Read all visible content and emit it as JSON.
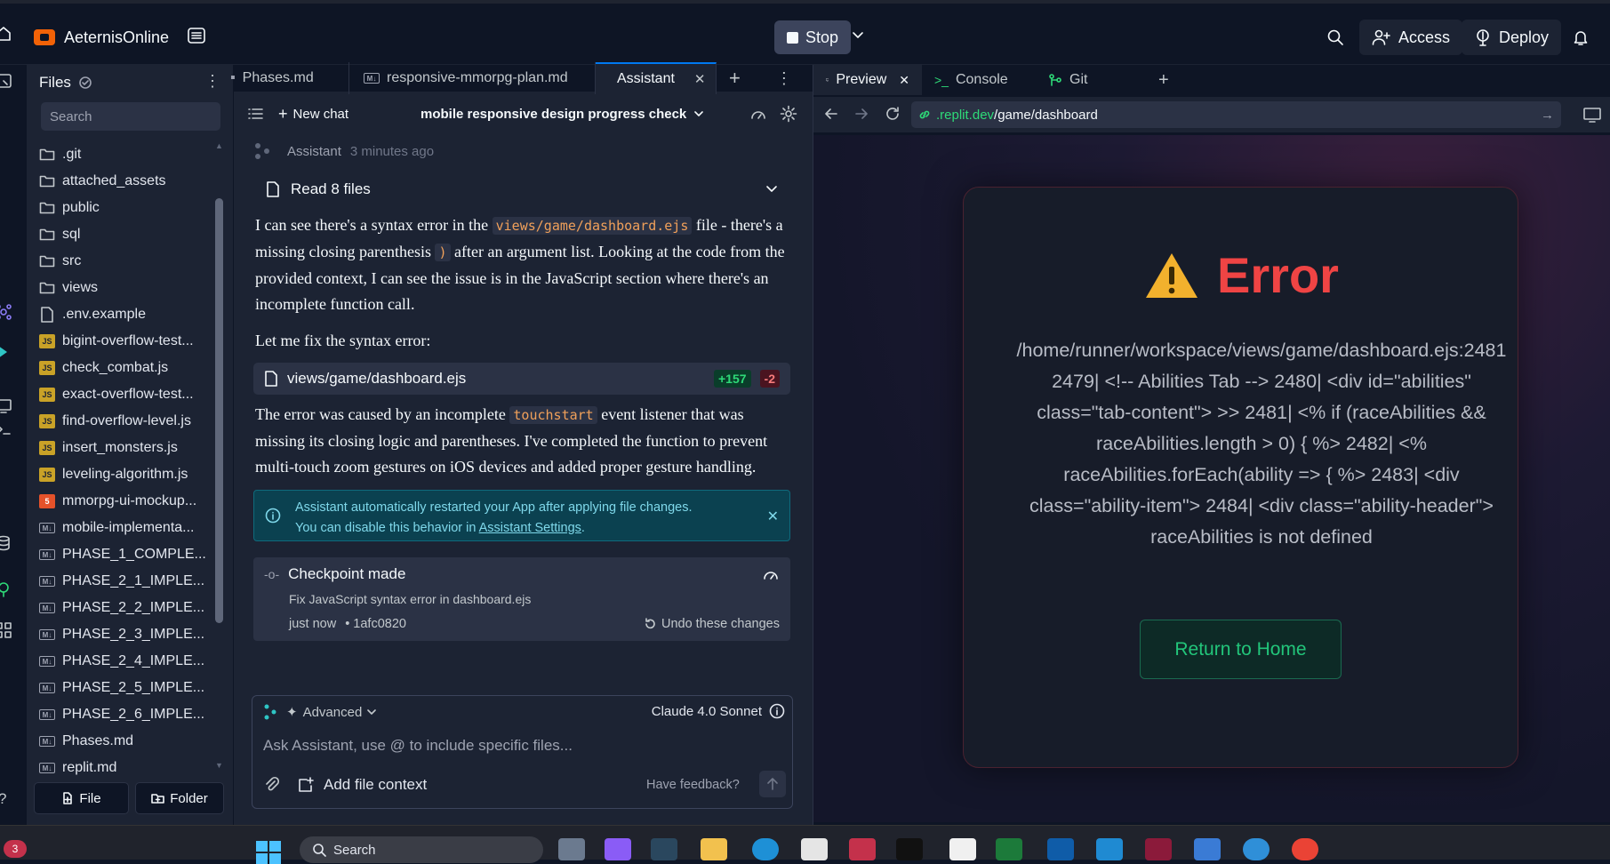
{
  "topbar": {
    "repl_name": "AeternisOnline",
    "stop_label": "Stop",
    "access_label": "Access",
    "deploy_label": "Deploy"
  },
  "files": {
    "title": "Files",
    "search_placeholder": "Search",
    "items": [
      {
        "name": ".git",
        "icon": "folder-icon"
      },
      {
        "name": "attached_assets",
        "icon": "folder-icon"
      },
      {
        "name": "public",
        "icon": "folder-icon"
      },
      {
        "name": "sql",
        "icon": "folder-icon"
      },
      {
        "name": "src",
        "icon": "folder-icon"
      },
      {
        "name": "views",
        "icon": "folder-icon"
      },
      {
        "name": ".env.example",
        "icon": "file-icon"
      },
      {
        "name": "bigint-overflow-test...",
        "icon": "js-file-icon"
      },
      {
        "name": "check_combat.js",
        "icon": "js-file-icon"
      },
      {
        "name": "exact-overflow-test...",
        "icon": "js-file-icon"
      },
      {
        "name": "find-overflow-level.js",
        "icon": "js-file-icon"
      },
      {
        "name": "insert_monsters.js",
        "icon": "js-file-icon"
      },
      {
        "name": "leveling-algorithm.js",
        "icon": "js-file-icon"
      },
      {
        "name": "mmorpg-ui-mockup...",
        "icon": "html-file-icon"
      },
      {
        "name": "mobile-implementa...",
        "icon": "md-file-icon"
      },
      {
        "name": "PHASE_1_COMPLE...",
        "icon": "md-file-icon"
      },
      {
        "name": "PHASE_2_1_IMPLE...",
        "icon": "md-file-icon"
      },
      {
        "name": "PHASE_2_2_IMPLE...",
        "icon": "md-file-icon"
      },
      {
        "name": "PHASE_2_3_IMPLE...",
        "icon": "md-file-icon"
      },
      {
        "name": "PHASE_2_4_IMPLE...",
        "icon": "md-file-icon"
      },
      {
        "name": "PHASE_2_5_IMPLE...",
        "icon": "md-file-icon"
      },
      {
        "name": "PHASE_2_6_IMPLE...",
        "icon": "md-file-icon"
      },
      {
        "name": "Phases.md",
        "icon": "md-file-icon"
      },
      {
        "name": "replit.md",
        "icon": "md-file-icon"
      }
    ],
    "new_file_label": "File",
    "new_folder_label": "Folder"
  },
  "editor_tabs": [
    {
      "label": "Phases.md"
    },
    {
      "label": "responsive-mmorpg-plan.md"
    },
    {
      "label": "Assistant"
    }
  ],
  "chat": {
    "new_chat_label": "New chat",
    "chat_title": "mobile responsive design progress check",
    "sender": "Assistant",
    "time": "3 minutes ago",
    "read_files": "Read 8 files",
    "p1_a": "I can see there's a syntax error in the ",
    "p1_code": "views/game/dashboard.ejs",
    "p1_b": " file - there's a missing closing parenthesis ",
    "p1_code2": ")",
    "p1_c": " after an argument list. Looking at the code from the provided context, I can see the issue is in the JavaScript section where there's an incomplete function call.",
    "p2": "Let me fix the syntax error:",
    "edited_file": "views/game/dashboard.ejs",
    "added": "+157",
    "removed": "-2",
    "p3_a": "The error was caused by an incomplete ",
    "p3_code": "touchstart",
    "p3_b": " event listener that was missing its closing logic and parentheses. I've completed the function to prevent multi-touch zoom gestures on iOS devices and added proper gesture handling.",
    "notice_line1": "Assistant automatically restarted your App after applying file changes.",
    "notice_line2": "You can disable this behavior in ",
    "notice_link": "Assistant Settings",
    "notice_end": ".",
    "checkpoint_title": "Checkpoint made",
    "checkpoint_desc": "Fix JavaScript syntax error in dashboard.ejs",
    "checkpoint_time": "just now",
    "checkpoint_hash": "• 1afc0820",
    "undo_label": "Undo these changes"
  },
  "composer": {
    "mode": "Advanced",
    "model": "Claude 4.0 Sonnet",
    "placeholder": "Ask Assistant, use @ to include specific files...",
    "add_context": "Add file context",
    "feedback": "Have feedback?"
  },
  "preview": {
    "tabs": [
      {
        "label": "Preview"
      },
      {
        "label": "Console"
      },
      {
        "label": "Git"
      }
    ],
    "url_domain": ".replit.dev",
    "url_path": "/game/dashboard",
    "error_title": "Error",
    "error_message": "/home/runner/workspace/views/game/dashboard.ejs:2481 2479| <!-- Abilities Tab --> 2480| <div id=\"abilities\" class=\"tab-content\"> >> 2481| <% if (raceAbilities && raceAbilities.length > 0) { %> 2482| <% raceAbilities.forEach(ability => { %> 2483| <div class=\"ability-item\"> 2484| <div class=\"ability-header\"> raceAbilities is not defined",
    "return_home": "Return to Home"
  },
  "taskbar": {
    "search_label": "Search",
    "notification_count": "3"
  },
  "colors": {
    "background": "#0e1525",
    "panel": "#1c2333",
    "accent": "#0079f2",
    "error": "#ef4444",
    "success": "#22c57a"
  }
}
